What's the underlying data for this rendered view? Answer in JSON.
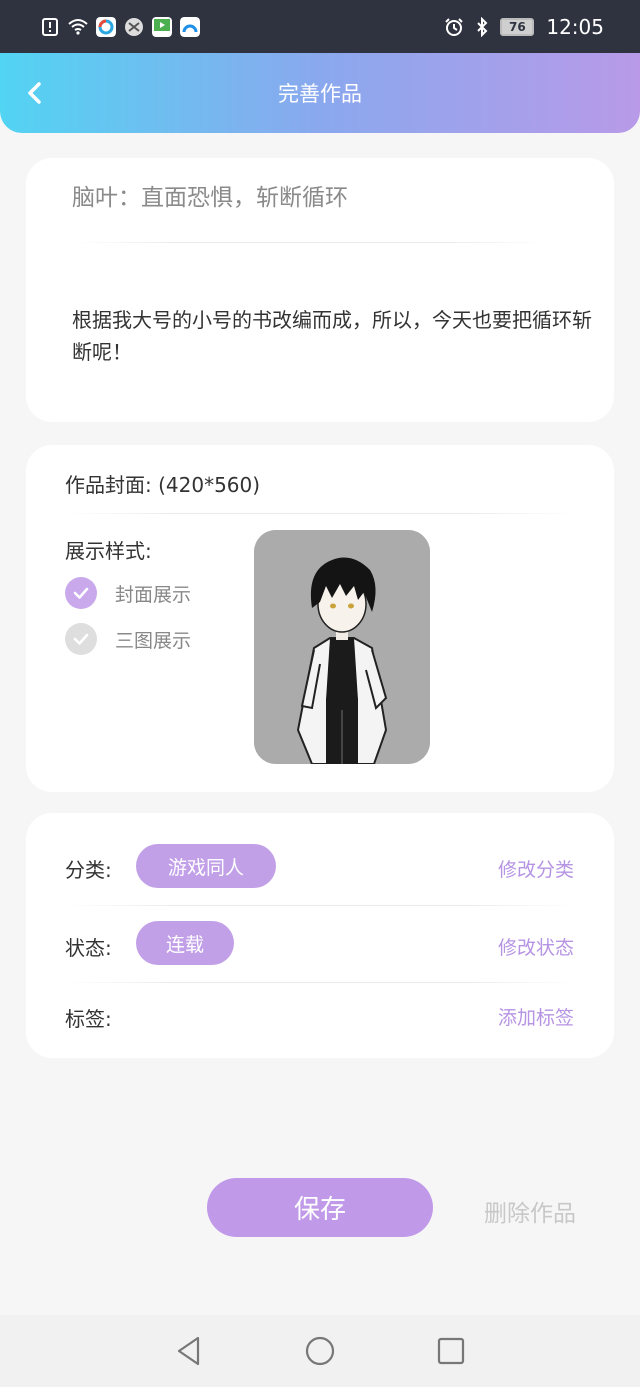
{
  "status_bar": {
    "time": "12:05",
    "battery": "76",
    "icons": [
      "alert-icon",
      "wifi-icon",
      "app-icon-1",
      "app-icon-2",
      "app-icon-3",
      "app-icon-4",
      "alarm-icon",
      "bluetooth-icon"
    ]
  },
  "header": {
    "title": "完善作品",
    "back_icon": "chevron-left-icon"
  },
  "work": {
    "title": "脑叶：直面恐惧，斩断循环",
    "description": "根据我大号的小号的书改编而成，所以，今天也要把循环斩断呢！"
  },
  "cover": {
    "label": "作品封面: (420*560)",
    "display_label": "展示样式:",
    "options": [
      {
        "label": "封面展示",
        "selected": true
      },
      {
        "label": "三图展示",
        "selected": false
      }
    ]
  },
  "meta": {
    "category_label": "分类:",
    "category_value": "游戏同人",
    "category_action": "修改分类",
    "status_label": "状态:",
    "status_value": "连载",
    "status_action": "修改状态",
    "tags_label": "标签:",
    "tags_action": "添加标签"
  },
  "actions": {
    "save": "保存",
    "delete": "删除作品"
  },
  "colors": {
    "accent": "#c09ae8",
    "header_start": "#52d4f3",
    "header_end": "#b89ae8"
  }
}
